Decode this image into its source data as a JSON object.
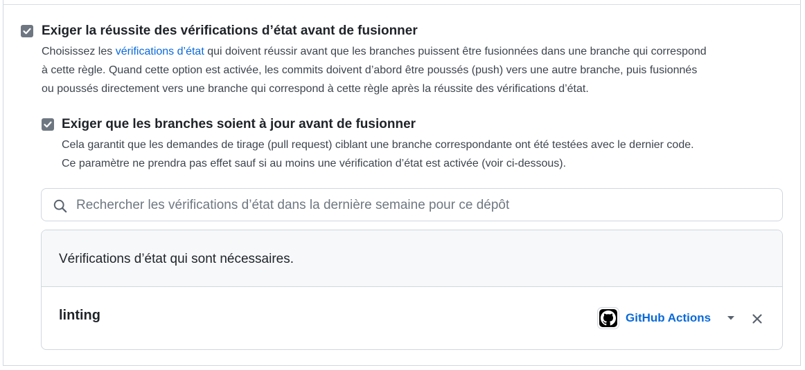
{
  "status_checks": {
    "title": "Exiger la réussite des vérifications d’état avant de fusionner",
    "checked": true,
    "desc_pre": "Choisissez les ",
    "desc_link": "vérifications d’état",
    "desc_line1_rest": " qui doivent réussir avant que les branches puissent être fusionnées dans une branche qui correspond",
    "desc_line2": "à cette règle. Quand cette option est activée, les commits doivent d’abord être poussés (push) vers une autre branche, puis fusionnés",
    "desc_line3": "ou poussés directement vers une branche qui correspond à cette règle après la réussite des vérifications d’état."
  },
  "up_to_date": {
    "title": "Exiger que les branches soient à jour avant de fusionner",
    "checked": true,
    "desc_line1": "Cela garantit que les demandes de tirage (pull request) ciblant une branche correspondante ont été testées avec le dernier code.",
    "desc_line2": "Ce paramètre ne prendra pas effet sauf si au moins une vérification d’état est activée (voir ci-dessous)."
  },
  "search": {
    "placeholder": "Rechercher les vérifications d’état dans la dernière semaine pour ce dépôt",
    "value": ""
  },
  "required_checks": {
    "header": "Vérifications d’état qui sont nécessaires.",
    "items": [
      {
        "name": "linting",
        "app": "GitHub Actions",
        "app_icon": "github-logo"
      }
    ]
  },
  "colors": {
    "link": "#0969da",
    "checkbox": "#6e7781",
    "border": "#d0d7de",
    "header_bg": "#f6f8fa"
  }
}
